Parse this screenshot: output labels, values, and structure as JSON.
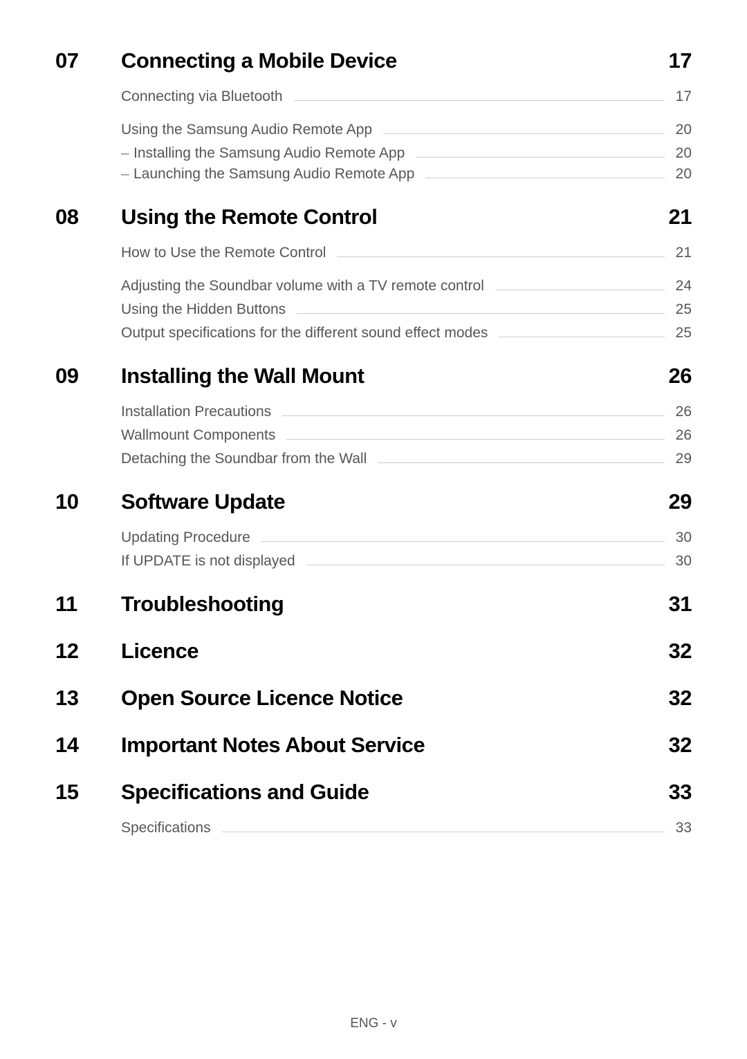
{
  "sections": [
    {
      "num": "07",
      "title": "Connecting a Mobile Device",
      "page": "17",
      "entries": [
        {
          "text": "Connecting via Bluetooth",
          "page": "17",
          "gapAfter": true
        },
        {
          "text": "Using the Samsung Audio Remote App",
          "page": "20"
        },
        {
          "text": "Installing the Samsung Audio Remote App",
          "page": "20",
          "sub": true
        },
        {
          "text": "Launching the Samsung Audio Remote App",
          "page": "20",
          "sub": true
        }
      ]
    },
    {
      "num": "08",
      "title": "Using the Remote Control",
      "page": "21",
      "entries": [
        {
          "text": "How to Use the Remote Control",
          "page": "21",
          "gapAfter": true
        },
        {
          "text": "Adjusting the Soundbar volume with a TV remote control",
          "page": "24"
        },
        {
          "text": "Using the Hidden Buttons",
          "page": "25"
        },
        {
          "text": "Output specifications for the different sound effect modes",
          "page": "25"
        }
      ]
    },
    {
      "num": "09",
      "title": "Installing the Wall Mount",
      "page": "26",
      "entries": [
        {
          "text": "Installation Precautions",
          "page": "26"
        },
        {
          "text": "Wallmount Components",
          "page": "26"
        },
        {
          "text": "Detaching the Soundbar from the Wall",
          "page": "29"
        }
      ]
    },
    {
      "num": "10",
      "title": "Software Update",
      "page": "29",
      "entries": [
        {
          "text": "Updating Procedure",
          "page": "30"
        },
        {
          "text": "If UPDATE is not displayed",
          "page": "30"
        }
      ]
    },
    {
      "num": "11",
      "title": "Troubleshooting",
      "page": "31",
      "entries": []
    },
    {
      "num": "12",
      "title": "Licence",
      "page": "32",
      "entries": []
    },
    {
      "num": "13",
      "title": "Open Source Licence Notice",
      "page": "32",
      "entries": []
    },
    {
      "num": "14",
      "title": "Important Notes About Service",
      "page": "32",
      "entries": []
    },
    {
      "num": "15",
      "title": "Specifications and Guide",
      "page": "33",
      "entries": [
        {
          "text": "Specifications",
          "page": "33"
        }
      ]
    }
  ],
  "footer": "ENG - v"
}
